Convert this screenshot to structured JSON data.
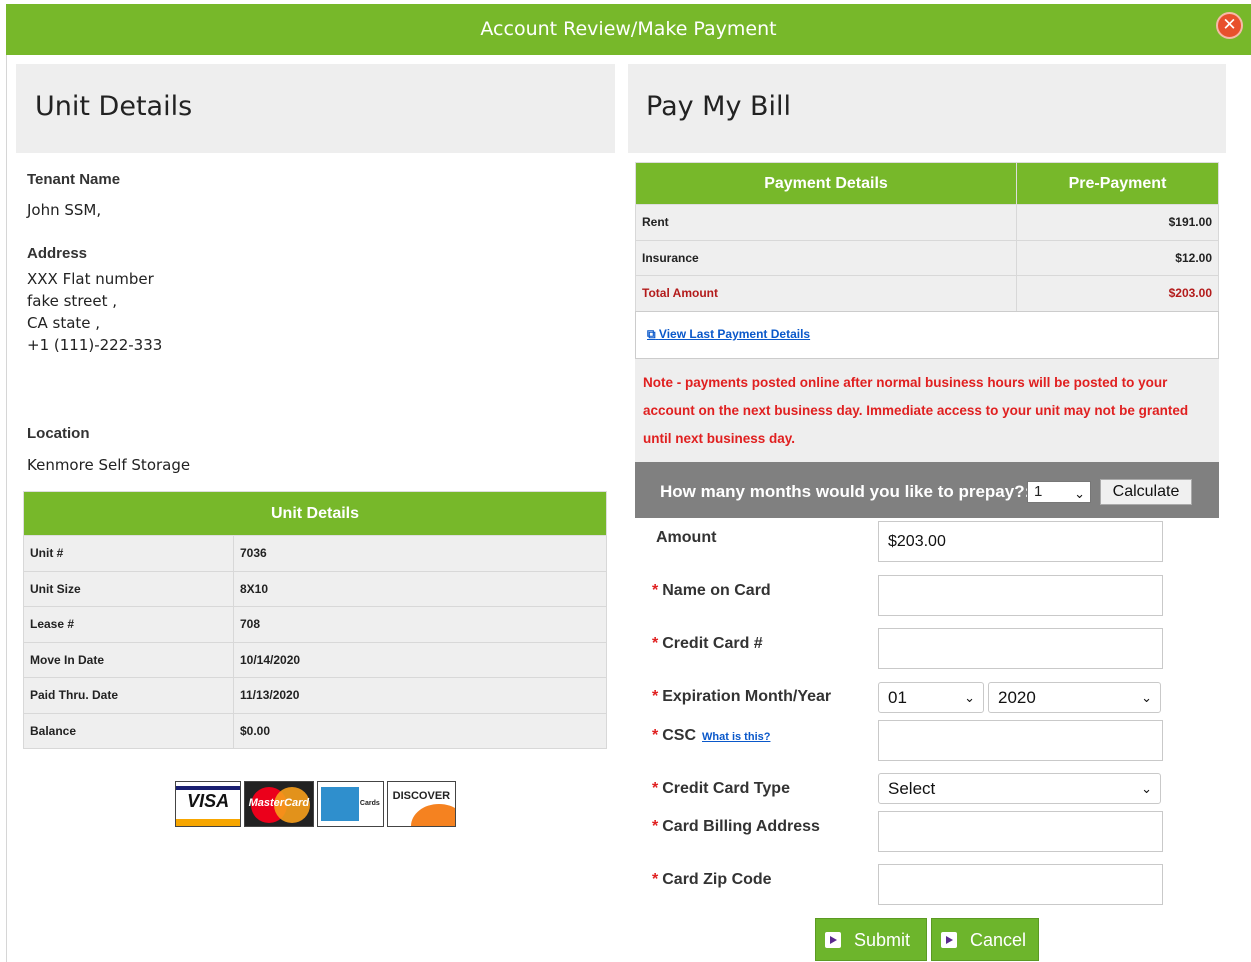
{
  "window": {
    "title": "Account Review/Make Payment"
  },
  "unit_panel": {
    "heading": "Unit Details",
    "tenant_label": "Tenant Name",
    "tenant_value": "John SSM,",
    "address_label": "Address",
    "address_lines": [
      "XXX Flat number",
      "fake street ,",
      "CA state  ,",
      "+1 (111)-222-333"
    ],
    "location_label": "Location",
    "location_value": "Kenmore Self Storage",
    "table_header": "Unit Details",
    "rows": [
      {
        "label": "Unit #",
        "value": "7036"
      },
      {
        "label": "Unit Size",
        "value": "8X10"
      },
      {
        "label": "Lease #",
        "value": "708"
      },
      {
        "label": "Move In Date",
        "value": "10/14/2020"
      },
      {
        "label": "Paid Thru. Date",
        "value": "11/13/2020"
      },
      {
        "label": "Balance",
        "value": "$0.00"
      }
    ],
    "card_logos": {
      "visa": "VISA",
      "mastercard": "MasterCard",
      "amex": "Cards",
      "discover": "DISCOVER"
    }
  },
  "pay_panel": {
    "heading": "Pay My Bill",
    "col1": "Payment Details",
    "col2": "Pre-Payment",
    "rows": [
      {
        "label": "Rent",
        "amount": "$191.00"
      },
      {
        "label": "Insurance",
        "amount": "$12.00"
      },
      {
        "label": "Total Amount",
        "amount": "$203.00"
      }
    ],
    "last_payment_link": "View Last Payment Details",
    "note": "Note - payments posted online after normal business hours will be posted to your account on the next business day. Immediate access to your unit may not be granted until next business day.",
    "prepay_question": "How many months would you like to prepay?:",
    "prepay_months": "1",
    "calculate_label": "Calculate",
    "amount_label": "Amount",
    "amount_value": "$203.00",
    "required_mark": "*",
    "name_label": "Name on  Card",
    "cc_label": "Credit Card #",
    "exp_label": "Expiration Month/Year",
    "exp_month": "01",
    "exp_year": "2020",
    "csc_label": "CSC",
    "csc_help": "What is this?",
    "cctype_label": "Credit Card Type",
    "cctype_value": "Select",
    "billing_label": "Card Billing Address",
    "zip_label": "Card Zip Code",
    "submit_label": "Submit",
    "cancel_label": "Cancel"
  },
  "colors": {
    "accent_green": "#77b82a",
    "note_red": "#e02020",
    "close_orange": "#e8502d"
  },
  "icons": {
    "close": "close-icon",
    "external": "external-link-icon",
    "chevron": "chevron-down-icon",
    "play": "play-icon"
  }
}
